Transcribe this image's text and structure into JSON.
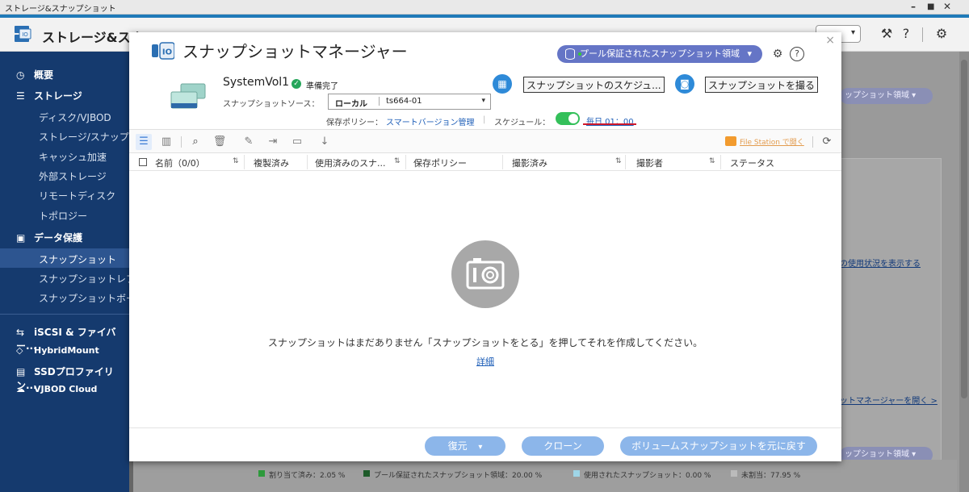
{
  "window": {
    "title": "ストレージ&スナップショット",
    "controls": {
      "minimize": "–",
      "maximize": "■",
      "close": "✕"
    }
  },
  "app": {
    "title": "ストレージ&スナ",
    "dropdown_arrow": "▾"
  },
  "sidebar": {
    "sections": [
      {
        "icon": "◷",
        "label": "概要"
      },
      {
        "icon": "☰",
        "label": "ストレージ"
      },
      {
        "icon": "▣",
        "label": "データ保護"
      },
      {
        "icon": "⇆",
        "label": "iSCSI & ファイバー..."
      },
      {
        "icon": "◇",
        "label": "HybridMount"
      },
      {
        "icon": "▤",
        "label": "SSDプロファイリン..."
      },
      {
        "icon": "☁",
        "label": "VJBOD Cloud"
      }
    ],
    "storage_items": [
      "ディスク/VJBOD",
      "ストレージ/スナップショ",
      "キャッシュ加速",
      "外部ストレージ",
      "リモートディスク",
      "トポロジー"
    ],
    "protection_items": [
      "スナップショット",
      "スナップショットレプリ",
      "スナップショットボール"
    ]
  },
  "background": {
    "pill_top": "ップショット領域 ▾",
    "link_usage": "の使用状況を表示する",
    "link_manager": "ットマネージャーを開く >",
    "pill_bottom": "ップショット領域 ▾",
    "legend": [
      "割り当て済み：2.05 %",
      "プール保証されたスナップショット領域：20.00 %",
      "使用されたスナップショット：0.00 %",
      "未割当：77.95 %"
    ]
  },
  "modal": {
    "title": "スナップショットマネージャー",
    "close": "×",
    "pool_pill": "プール保証されたスナップショット領域",
    "pool_arrow": "▾",
    "volume": {
      "name": "SystemVol1",
      "status": "準備完了",
      "source_label": "スナップショットソース：",
      "source_location": "ローカル",
      "source_device": "ts664-01",
      "policy_label": "保存ポリシー：",
      "policy_value": "スマートバージョン管理",
      "schedule_label": "スケジュール：",
      "schedule_time": "毎日 01：00"
    },
    "actions": {
      "schedule_button": "スナップショットのスケジュ...",
      "take_button": "スナップショットを撮る"
    },
    "toolbar": {
      "file_station": "File Station で開く"
    },
    "table": {
      "columns": [
        "名前（0/0）",
        "複製済み",
        "使用済みのスナ...",
        "保存ポリシー",
        "撮影済み",
        "撮影者",
        "ステータス"
      ],
      "sort_glyph": "⇅"
    },
    "empty": {
      "message": "スナップショットはまだありません「スナップショットをとる」を押してそれを作成してください。",
      "detail_link": "詳細"
    },
    "footer": {
      "restore": "復元",
      "restore_arrow": "▾",
      "clone": "クローン",
      "revert": "ボリュームスナップショットを元に戻す"
    }
  }
}
